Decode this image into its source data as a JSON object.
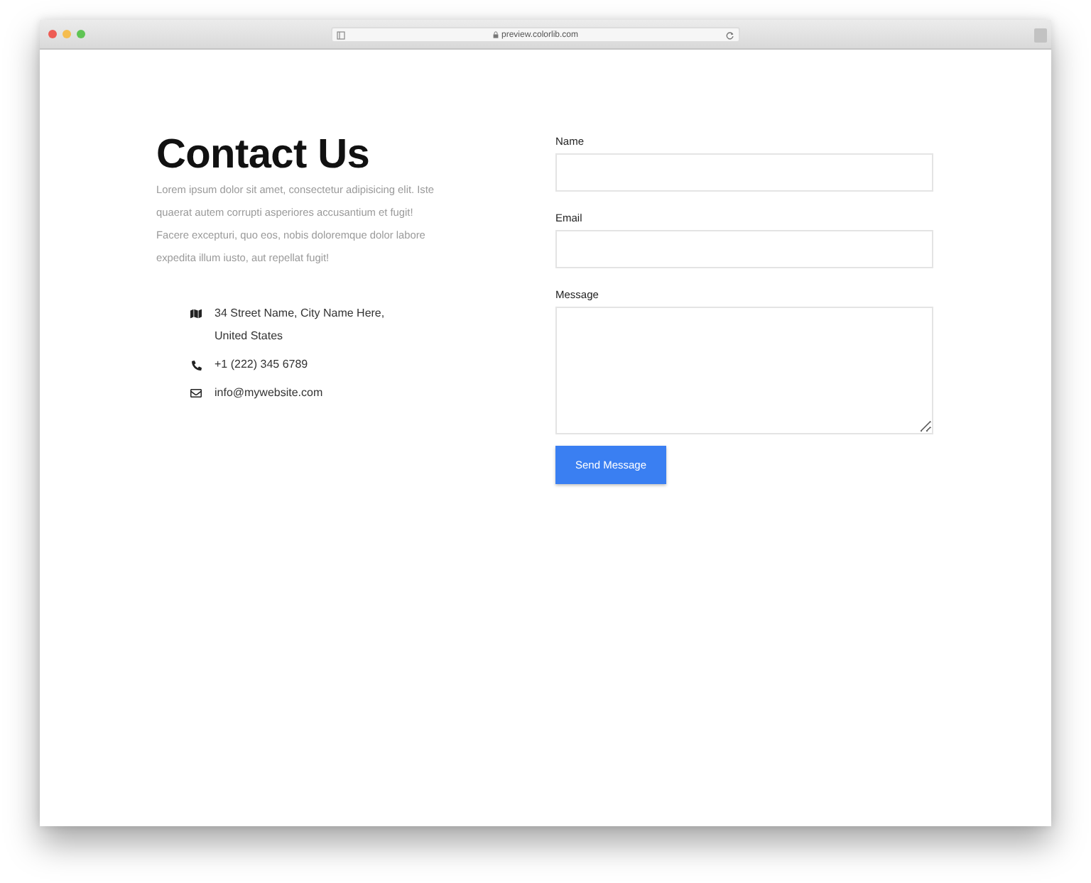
{
  "browser": {
    "url": "preview.colorlib.com"
  },
  "contact": {
    "heading": "Contact Us",
    "text": "Lorem ipsum dolor sit amet, consectetur adipisicing elit. Iste quaerat autem corrupti asperiores accusantium et fugit! Facere excepturi, quo eos, nobis doloremque dolor labore expedita illum iusto, aut repellat fugit!",
    "items": [
      {
        "kind": "address",
        "text": "34 Street Name, City Name Here, United States"
      },
      {
        "kind": "phone",
        "text": "+1 (222) 345 6789"
      },
      {
        "kind": "email",
        "text": "info@mywebsite.com"
      }
    ]
  },
  "form": {
    "fields": [
      {
        "kind": "input",
        "label": "Name"
      },
      {
        "kind": "input",
        "label": "Email"
      },
      {
        "kind": "textarea",
        "label": "Message"
      }
    ],
    "button": "Send Message"
  }
}
